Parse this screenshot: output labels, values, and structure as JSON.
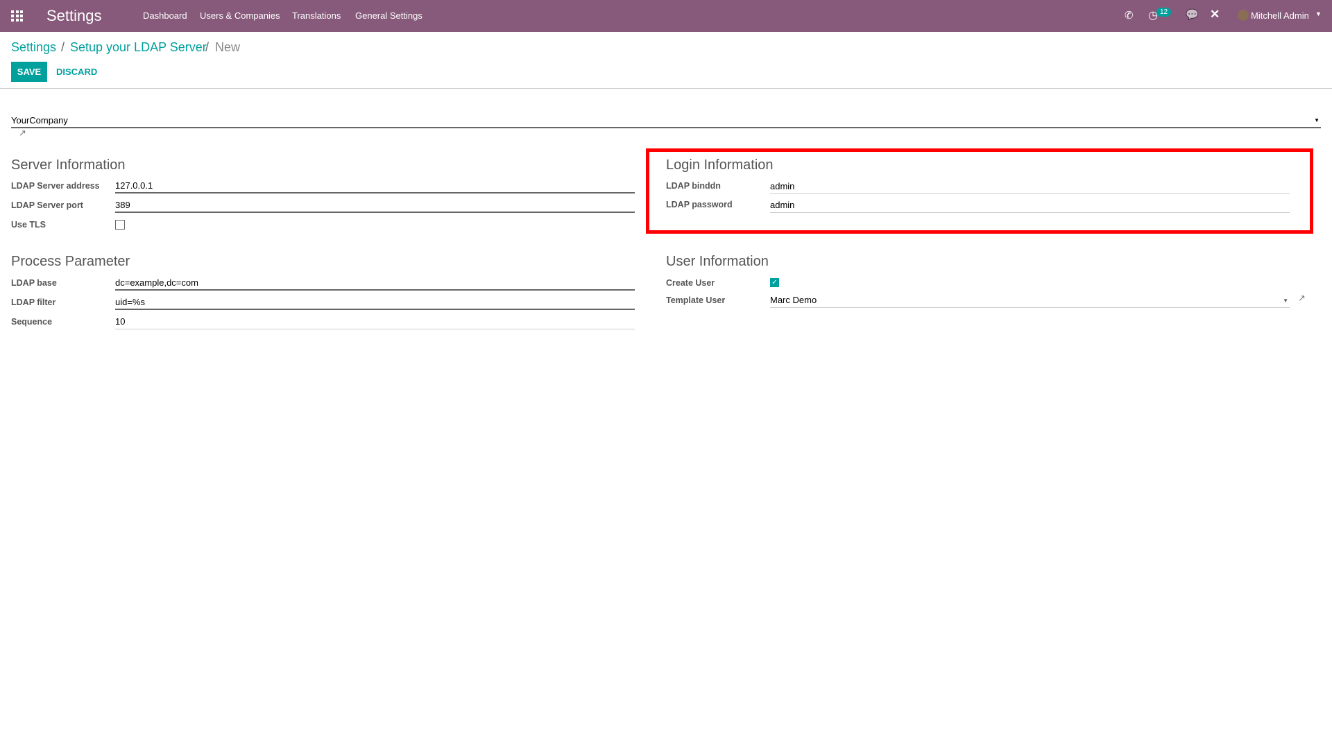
{
  "navbar": {
    "app_title": "Settings",
    "menu": [
      "Dashboard",
      "Users & Companies",
      "Translations",
      "General Settings"
    ],
    "activity_count": "12",
    "user_name": "Mitchell Admin",
    "color": "#875A7B"
  },
  "breadcrumb": {
    "items": [
      "Settings",
      "Setup your LDAP Server"
    ],
    "current": "New",
    "separator": "/"
  },
  "actions": {
    "save": "SAVE",
    "discard": "DISCARD"
  },
  "company": {
    "value": "YourCompany"
  },
  "server_info": {
    "title": "Server Information",
    "address_label": "LDAP Server address",
    "address": "127.0.0.1",
    "port_label": "LDAP Server port",
    "port": "389",
    "tls_label": "Use TLS",
    "tls": false
  },
  "process": {
    "title": "Process Parameter",
    "base_label": "LDAP base",
    "base": "dc=example,dc=com",
    "filter_label": "LDAP filter",
    "filter": "uid=%s",
    "sequence_label": "Sequence",
    "sequence": "10"
  },
  "login": {
    "title": "Login Information",
    "binddn_label": "LDAP binddn",
    "binddn": "admin",
    "password_label": "LDAP password",
    "password": "admin"
  },
  "user_info": {
    "title": "User Information",
    "create_label": "Create User",
    "create": true,
    "template_label": "Template User",
    "template": "Marc Demo"
  },
  "accent": "#00A09D"
}
